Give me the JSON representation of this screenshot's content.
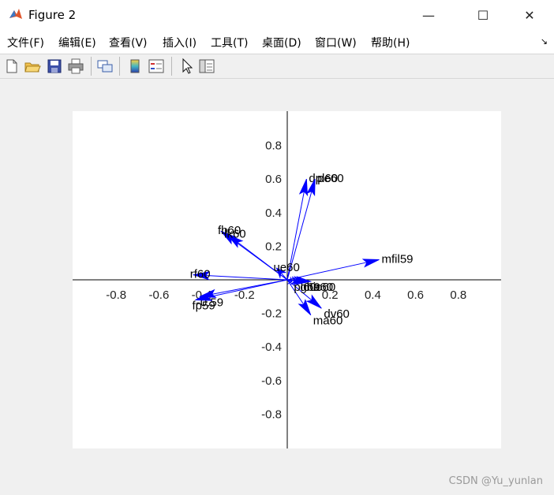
{
  "window": {
    "title": "Figure 2",
    "minimize_glyph": "—",
    "maximize_glyph": "☐",
    "close_glyph": "✕",
    "icon": "matlab-icon"
  },
  "menubar": {
    "items": [
      "文件(F)",
      "编辑(E)",
      "查看(V)",
      "插入(I)",
      "工具(T)",
      "桌面(D)",
      "窗口(W)",
      "帮助(H)"
    ],
    "overflow_glyph": "↘"
  },
  "toolbar": {
    "buttons": [
      "new-figure-icon",
      "open-file-icon",
      "save-icon",
      "print-icon",
      "link-plot-icon",
      "colorbar-icon",
      "legend-icon",
      "pointer-icon",
      "property-editor-icon"
    ]
  },
  "watermark": "CSDN @Yu_yunlan",
  "chart_data": {
    "type": "biplot",
    "title": "",
    "xlabel": "",
    "ylabel": "",
    "xlim": [
      -1,
      1
    ],
    "ylim": [
      -1,
      1
    ],
    "x_ticks": [
      -0.8,
      -0.6,
      -0.4,
      -0.2,
      0.2,
      0.4,
      0.6,
      0.8
    ],
    "y_ticks": [
      -0.8,
      -0.6,
      -0.4,
      -0.2,
      0.2,
      0.4,
      0.6,
      0.8
    ],
    "x_tick_labels": [
      "-0.8",
      "-0.6",
      "-0.4",
      "-0.2",
      "0.2",
      "0.4",
      "0.6",
      "0.8"
    ],
    "y_tick_labels": [
      "-0.8",
      "-0.6",
      "-0.4",
      "-0.2",
      "0.2",
      "0.4",
      "0.6",
      "0.8"
    ],
    "vector_color": "#0000ff",
    "vectors": [
      {
        "label": "dpl60",
        "x": 0.09,
        "y": 0.6
      },
      {
        "label": "pe60",
        "x": 0.13,
        "y": 0.6
      },
      {
        "label": "fb60",
        "x": -0.31,
        "y": 0.29
      },
      {
        "label": "lk60",
        "x": -0.28,
        "y": 0.27
      },
      {
        "label": "ue60",
        "x": -0.05,
        "y": 0.07
      },
      {
        "label": "rf60",
        "x": -0.44,
        "y": 0.03
      },
      {
        "label": "mfil59",
        "x": 0.43,
        "y": 0.12
      },
      {
        "label": "-0.59",
        "x": -0.41,
        "y": -0.1
      },
      {
        "label": "fp59",
        "x": -0.43,
        "y": -0.12
      },
      {
        "label": "dv60",
        "x": 0.16,
        "y": -0.17
      },
      {
        "label": "ma60",
        "x": 0.11,
        "y": -0.21
      },
      {
        "label": "pl60",
        "x": 0.02,
        "y": -0.01
      },
      {
        "label": "g60",
        "x": 0.05,
        "y": -0.01
      },
      {
        "label": "ha60",
        "x": 0.08,
        "y": -0.01
      },
      {
        "label": "io60",
        "x": 0.11,
        "y": -0.01
      }
    ]
  }
}
